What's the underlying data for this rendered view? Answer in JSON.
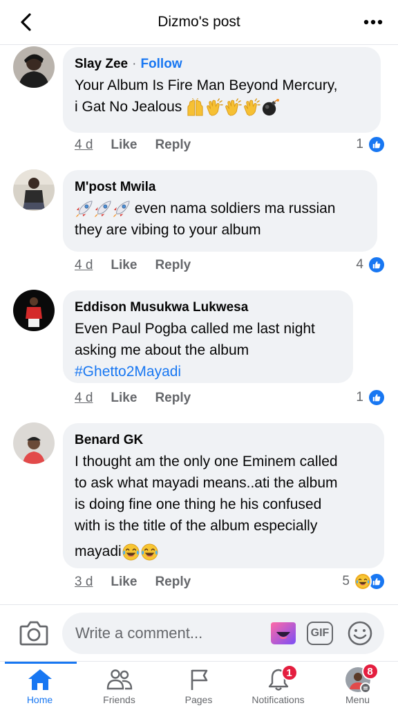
{
  "header": {
    "title": "Dizmo's post",
    "back_icon": "chevron-left-icon",
    "more_icon": "more-horizontal-icon"
  },
  "colors": {
    "accent": "#1877f2",
    "bubble": "#f0f2f5",
    "secondary_text": "#65676b",
    "badge_red": "#e41e3f"
  },
  "comments": [
    {
      "author": "Slay Zee",
      "follow_label": "Follow",
      "text_lines": [
        "Your Album Is Fire Man Beyond Mercury,",
        "i Gat No Jealous"
      ],
      "emojis": [
        "raising-hands",
        "clapping-hands",
        "clapping-hands",
        "clapping-hands",
        "bomb"
      ],
      "time": "4 d",
      "like_label": "Like",
      "reply_label": "Reply",
      "reaction_count": "1",
      "reactions": [
        "like"
      ]
    },
    {
      "author": "M'post Mwila",
      "emojis": [
        "rocket",
        "rocket",
        "rocket"
      ],
      "text_lines": [
        "even nama soldiers ma russian",
        "they are vibing to your album"
      ],
      "time": "4 d",
      "like_label": "Like",
      "reply_label": "Reply",
      "reaction_count": "4",
      "reactions": [
        "like"
      ]
    },
    {
      "author": "Eddison Musukwa Lukwesa",
      "text_lines": [
        "Even Paul Pogba called me last night",
        "asking me about the album"
      ],
      "hashtag": "#Ghetto2Mayadi",
      "time": "4 d",
      "like_label": "Like",
      "reply_label": "Reply",
      "reaction_count": "1",
      "reactions": [
        "like"
      ]
    },
    {
      "author": "Benard GK",
      "text_lines": [
        "I thought am the only one Eminem called",
        "to ask what mayadi means..ati the album",
        "is doing fine one thing he his confused",
        "with is the title of the album especially",
        "mayadi"
      ],
      "emojis": [
        "tears-of-joy",
        "tears-of-joy"
      ],
      "time": "3 d",
      "like_label": "Like",
      "reply_label": "Reply",
      "reaction_count": "5",
      "reactions": [
        "haha",
        "like"
      ]
    }
  ],
  "composer": {
    "placeholder": "Write a comment...",
    "gif_label": "GIF"
  },
  "tabs": [
    {
      "label": "Home",
      "icon": "home-icon",
      "active": true
    },
    {
      "label": "Friends",
      "icon": "friends-icon",
      "active": false
    },
    {
      "label": "Pages",
      "icon": "flag-icon",
      "active": false
    },
    {
      "label": "Notifications",
      "icon": "bell-icon",
      "active": false,
      "badge": "1"
    },
    {
      "label": "Menu",
      "icon": "profile-menu-icon",
      "active": false,
      "badge": "8"
    }
  ]
}
